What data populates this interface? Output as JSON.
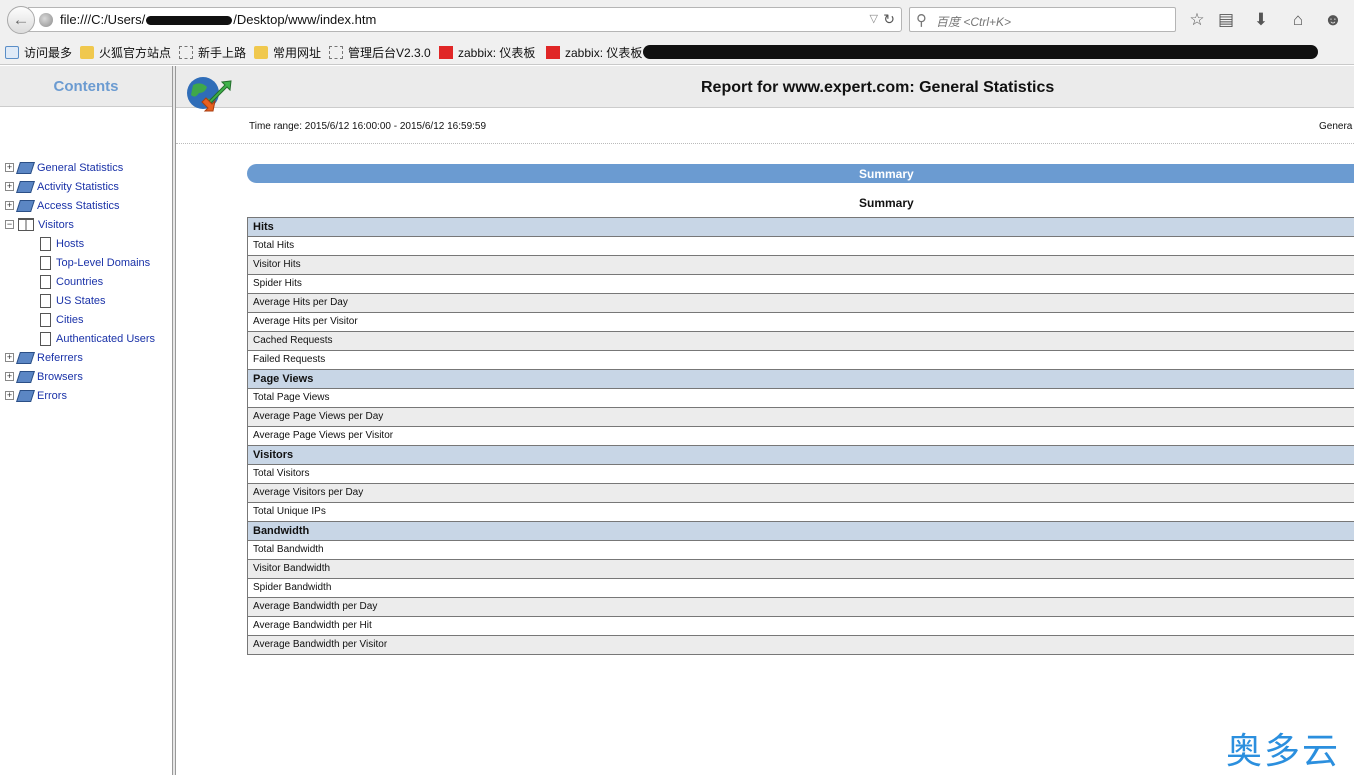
{
  "browser": {
    "url_prefix": "file:///C:/Users/",
    "url_suffix": "/Desktop/www/index.htm",
    "search_placeholder": "百度 <Ctrl+K>"
  },
  "bookmarks": [
    {
      "label": "访问最多",
      "icon": "search-icon"
    },
    {
      "label": "火狐官方站点",
      "icon": "folder-icon"
    },
    {
      "label": "新手上路",
      "icon": "dashed-page-icon"
    },
    {
      "label": "常用网址",
      "icon": "folder-icon"
    },
    {
      "label": "管理后台V2.3.0",
      "icon": "dashed-page-icon"
    },
    {
      "label": "zabbix: 仪表板",
      "icon": "zabbix-icon"
    },
    {
      "label": "zabbix: 仪表板",
      "icon": "zabbix-icon"
    }
  ],
  "sidebar": {
    "title": "Contents",
    "items": [
      {
        "label": "General Statistics"
      },
      {
        "label": "Activity Statistics"
      },
      {
        "label": "Access Statistics"
      },
      {
        "label": "Visitors"
      },
      {
        "label": "Hosts"
      },
      {
        "label": "Top-Level Domains"
      },
      {
        "label": "Countries"
      },
      {
        "label": "US States"
      },
      {
        "label": "Cities"
      },
      {
        "label": "Authenticated Users"
      },
      {
        "label": "Referrers"
      },
      {
        "label": "Browsers"
      },
      {
        "label": "Errors"
      }
    ]
  },
  "report": {
    "title": "Report for www.expert.com: General Statistics",
    "time_range": "Time range: 2015/6/12 16:00:00 - 2015/6/12 16:59:59",
    "right_cut": "Genera",
    "summary_bar": "Summary",
    "summary_title": "Summary"
  },
  "rows": [
    "Hits",
    "Total Hits",
    "Visitor Hits",
    "Spider Hits",
    "Average Hits per Day",
    "Average Hits per Visitor",
    "Cached Requests",
    "Failed Requests",
    "Page Views",
    "Total Page Views",
    "Average Page Views per Day",
    "Average Page Views per Visitor",
    "Visitors",
    "Total Visitors",
    "Average Visitors per Day",
    "Total Unique IPs",
    "Bandwidth",
    "Total Bandwidth",
    "Visitor Bandwidth",
    "Spider Bandwidth",
    "Average Bandwidth per Day",
    "Average Bandwidth per Hit",
    "Average Bandwidth per Visitor"
  ],
  "watermark": "奥多云"
}
